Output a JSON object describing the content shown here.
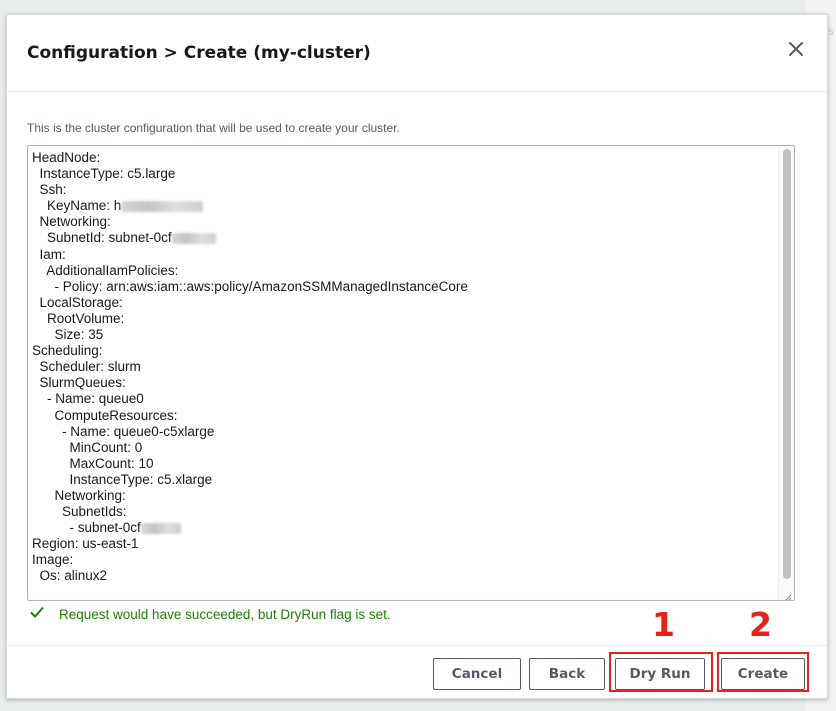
{
  "modal": {
    "title": "Configuration > Create (my-cluster)",
    "description": "This is the cluster configuration that will be used to create your cluster."
  },
  "config_lines": [
    "HeadNode:",
    "  InstanceType: c5.large",
    "  Ssh:",
    "    KeyName: h",
    "  Networking:",
    "    SubnetId: subnet-0cf",
    "  Iam:",
    "    AdditionalIamPolicies:",
    "      - Policy: arn:aws:iam::aws:policy/AmazonSSMManagedInstanceCore",
    "  LocalStorage:",
    "    RootVolume:",
    "      Size: 35",
    "Scheduling:",
    "  Scheduler: slurm",
    "  SlurmQueues:",
    "    - Name: queue0",
    "      ComputeResources:",
    "        - Name: queue0-c5xlarge",
    "          MinCount: 0",
    "          MaxCount: 10",
    "          InstanceType: c5.xlarge",
    "      Networking:",
    "        SubnetIds:",
    "          - subnet-0cf",
    "Region: us-east-1",
    "Image:",
    "  Os: alinux2"
  ],
  "status": {
    "text": "Request would have succeeded, but DryRun flag is set.",
    "icon": "check-icon",
    "color": "#1d8102"
  },
  "footer": {
    "cancel_label": "Cancel",
    "back_label": "Back",
    "dry_run_label": "Dry Run",
    "create_label": "Create"
  },
  "annotations": {
    "callout_1": "1",
    "callout_2": "2",
    "color": "#e8221b"
  },
  "background": {
    "partial_text": "rs"
  }
}
